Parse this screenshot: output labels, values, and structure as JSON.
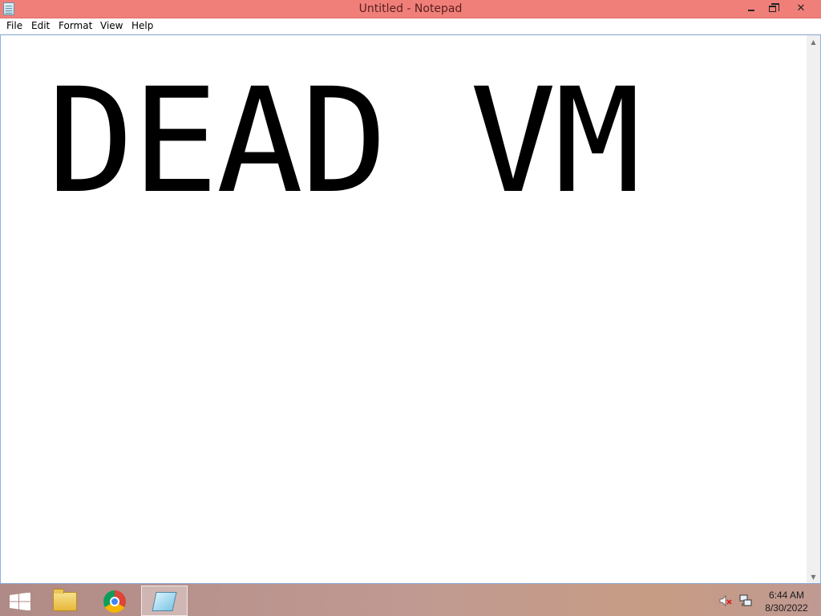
{
  "window": {
    "title": "Untitled - Notepad",
    "app_icon": "notepad-icon",
    "controls": {
      "minimize_icon": "minimize-icon",
      "restore_icon": "restore-icon",
      "close_label": "✕"
    }
  },
  "menu": {
    "items": [
      {
        "label": "File"
      },
      {
        "label": "Edit"
      },
      {
        "label": "Format"
      },
      {
        "label": "View"
      },
      {
        "label": "Help"
      }
    ]
  },
  "editor": {
    "text": "DEAD VM",
    "scroll_up_icon": "▲",
    "scroll_down_icon": "▼"
  },
  "taskbar": {
    "start_icon": "windows-logo-icon",
    "pinned": [
      {
        "name": "file-explorer",
        "icon": "folder-icon"
      },
      {
        "name": "google-chrome",
        "icon": "chrome-icon"
      },
      {
        "name": "notepad",
        "icon": "notepad-icon",
        "active": true
      }
    ],
    "tray": {
      "volume_icon": "volume-muted-icon",
      "network_icon": "network-icon",
      "time": "6:44 AM",
      "date": "8/30/2022"
    }
  },
  "colors": {
    "titlebar": "#f07f7a",
    "window_border": "#8db2e3"
  }
}
